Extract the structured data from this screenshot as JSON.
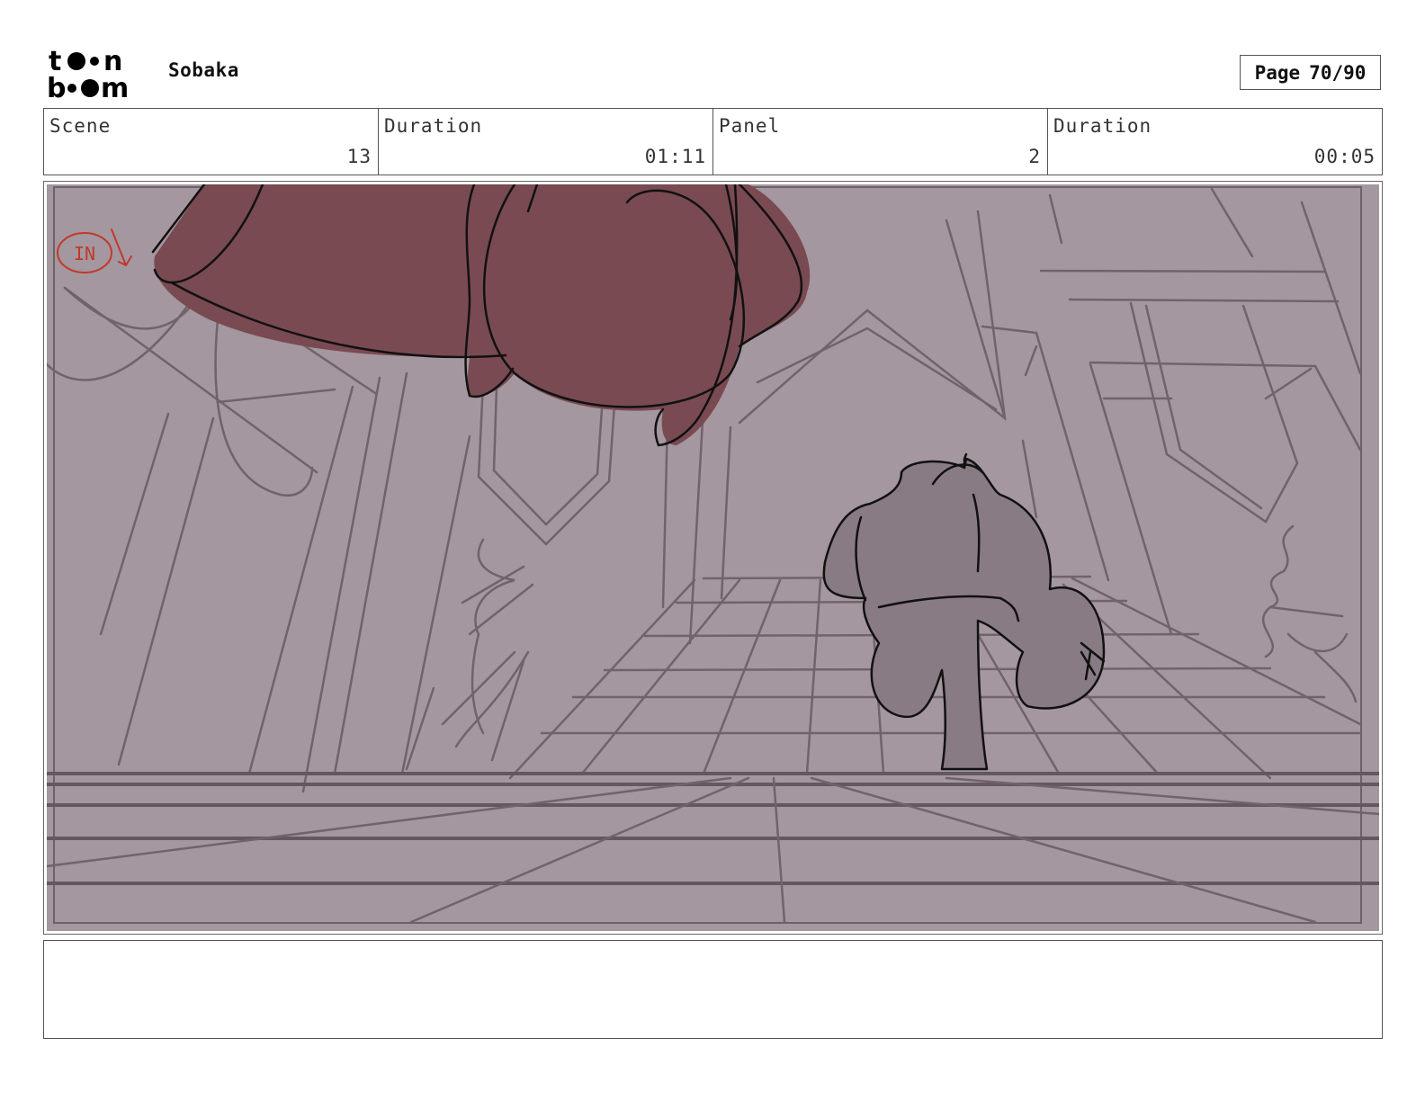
{
  "header": {
    "logo_text": "toon boom",
    "project": "Sobaka",
    "page_label": "Page",
    "page_value": "70/90"
  },
  "info": {
    "scene_label": "Scene",
    "scene_value": "13",
    "scene_duration_label": "Duration",
    "scene_duration_value": "01:11",
    "panel_label": "Panel",
    "panel_value": "2",
    "panel_duration_label": "Duration",
    "panel_duration_value": "00:05"
  },
  "panel": {
    "annotation": "IN",
    "colors": {
      "background": "#a4979f",
      "lines": "#70636b",
      "foreground_shape": "#794a52",
      "character": "#887b83",
      "annotation": "#c0392b"
    }
  },
  "notes": ""
}
